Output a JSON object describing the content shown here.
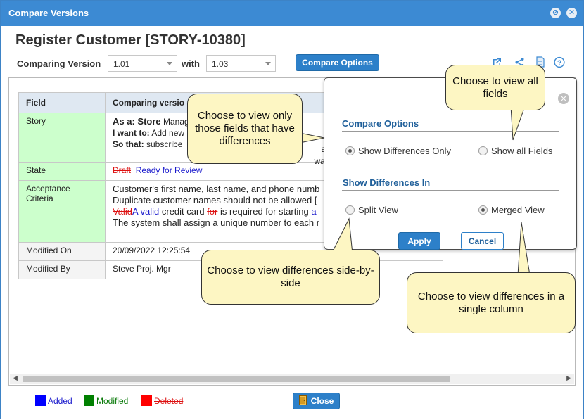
{
  "window": {
    "title": "Compare Versions"
  },
  "page_title": "Register Customer [STORY-10380]",
  "compare_bar": {
    "comparing_label": "Comparing Version",
    "version_from": "1.01",
    "with_label": "with",
    "version_to": "1.03",
    "compare_options_label": "Compare Options"
  },
  "table": {
    "headers": [
      "Field",
      "Comparing versio"
    ],
    "rows": [
      {
        "field": "Story",
        "line1_bold": "As a:",
        "line1_text": " Store",
        "line1_rest": " Manag",
        "line2_bold": "I want to:",
        "line2_text": " Add new",
        "line3_bold": "So that:",
        "line3_text": " subscribe",
        "overlap_1": "atio",
        "overlap_2": "watc"
      },
      {
        "field": "State",
        "deleted": "Draft",
        "added": "Ready for Review"
      },
      {
        "field": "Acceptance Criteria",
        "line1": "Customer's first name, last name, and phone numb",
        "line2": "Duplicate customer names should not be allowed [",
        "line3_del1": "Valid",
        "line3_add1": "A valid",
        "line3_text1": " credit card ",
        "line3_del2": "for",
        "line3_text2": " is required for starting ",
        "line3_add2": "a",
        "line4": "The system shall assign a unique number to each r"
      },
      {
        "field": "Modified On",
        "value": "20/09/2022 12:25:54"
      },
      {
        "field": "Modified By",
        "value": "Steve Proj. Mgr"
      }
    ]
  },
  "options_panel": {
    "section1_title": "Compare Options",
    "opt_diff_only": "Show Differences Only",
    "opt_all_fields": "Show all Fields",
    "section2_title": "Show Differences In",
    "opt_split": "Split View",
    "opt_merged": "Merged View",
    "apply": "Apply",
    "cancel": "Cancel",
    "selected_compare": "Show Differences Only",
    "selected_view": "Merged View"
  },
  "callouts": {
    "diff_only": "Choose to view only those fields that have differences",
    "all_fields": "Choose to view all fields",
    "split": "Choose to view differences side-by-side",
    "merged": "Choose to view differences in a single column"
  },
  "legend": {
    "added": "Added",
    "modified": "Modified",
    "deleted": "Deleted",
    "colors": {
      "added": "#0000ff",
      "modified": "#008000",
      "deleted": "#ff0000"
    }
  },
  "footer": {
    "close_label": "Close"
  },
  "icons": [
    "close-window-icon",
    "minimize-icon",
    "open-external-icon",
    "share-icon",
    "document-icon",
    "help-icon",
    "close-panel-icon",
    "door-icon"
  ]
}
